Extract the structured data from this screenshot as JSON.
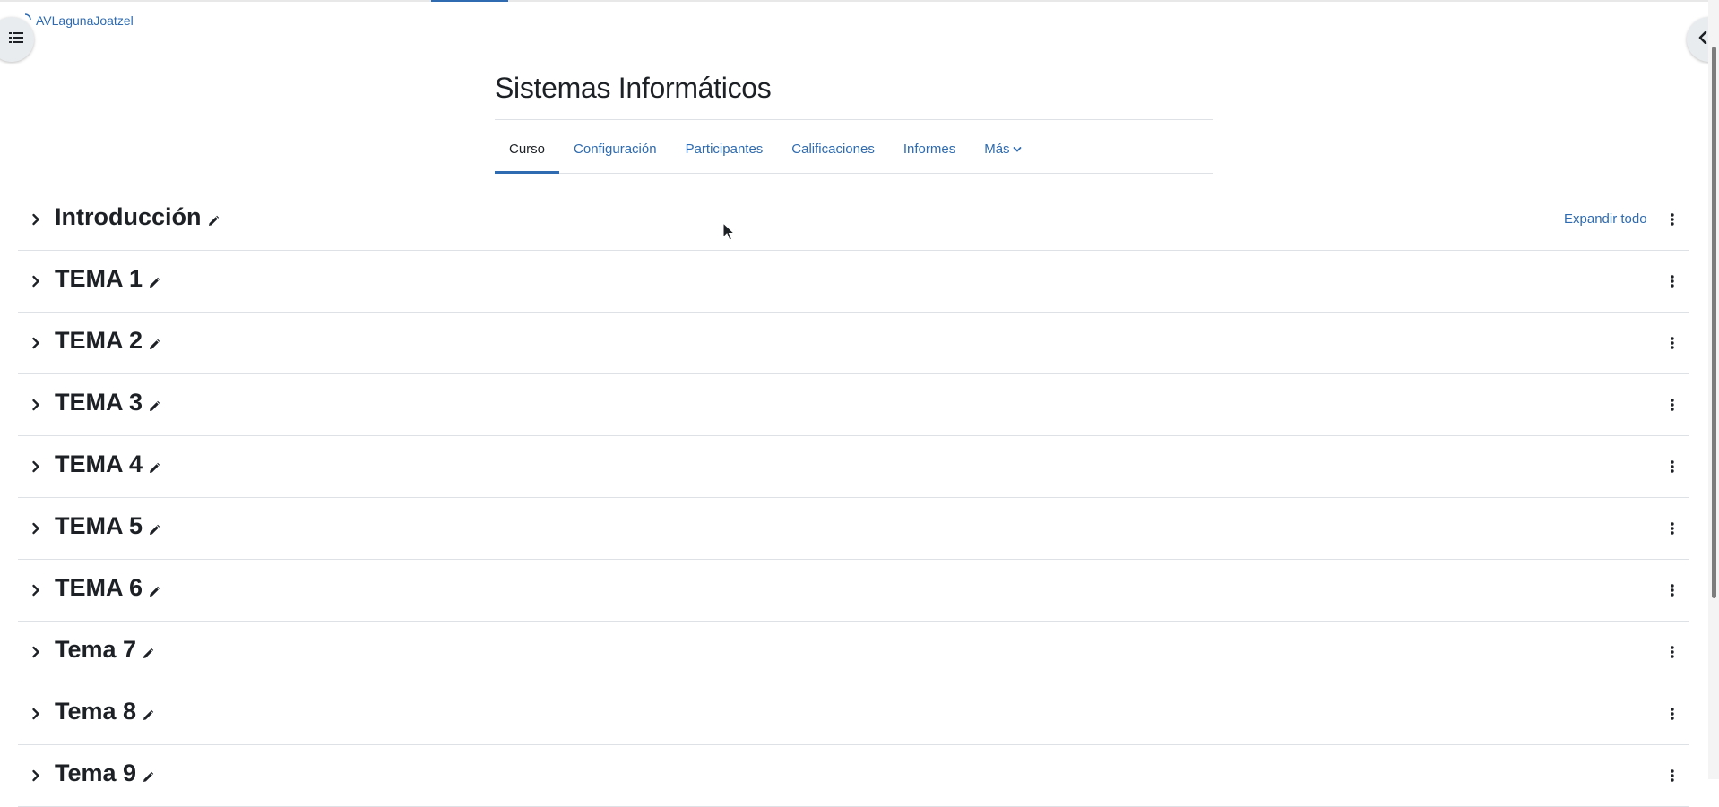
{
  "brand": {
    "site_name": "AVLagunaJoatzel"
  },
  "course": {
    "title": "Sistemas Informáticos"
  },
  "nav": {
    "tabs": [
      {
        "label": "Curso",
        "active": true
      },
      {
        "label": "Configuración",
        "active": false
      },
      {
        "label": "Participantes",
        "active": false
      },
      {
        "label": "Calificaciones",
        "active": false
      },
      {
        "label": "Informes",
        "active": false
      },
      {
        "label": "Más",
        "active": false
      }
    ]
  },
  "sections": {
    "expand_all_label": "Expandir todo",
    "items": [
      {
        "title": "Introducción"
      },
      {
        "title": "TEMA 1"
      },
      {
        "title": "TEMA 2"
      },
      {
        "title": "TEMA 3"
      },
      {
        "title": "TEMA 4"
      },
      {
        "title": "TEMA 5"
      },
      {
        "title": "TEMA 6"
      },
      {
        "title": "Tema 7"
      },
      {
        "title": "Tema 8"
      },
      {
        "title": "Tema 9"
      }
    ]
  },
  "icons": {
    "drawer_left": "list-icon",
    "drawer_right": "chevron-left-icon",
    "section_toggle": "chevron-right-icon",
    "edit": "pencil-icon",
    "menu": "kebab-menu-icon"
  },
  "colors": {
    "accent": "#2e6bb0",
    "text": "#1d2125",
    "divider": "#dee2e6"
  }
}
